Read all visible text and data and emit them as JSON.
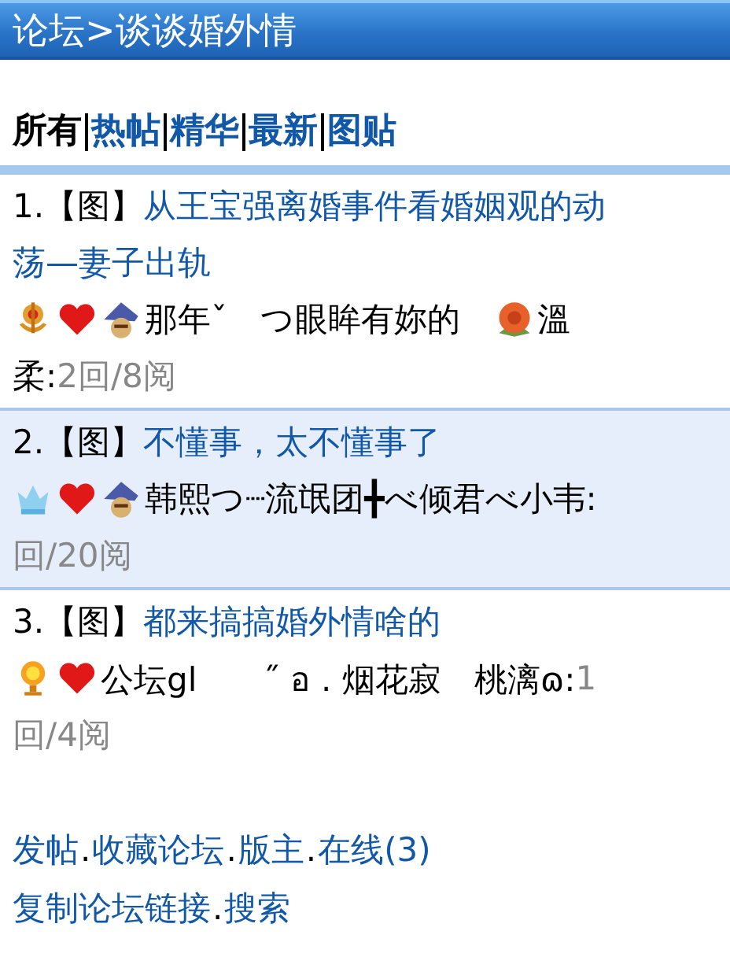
{
  "header": {
    "title": "论坛>谈谈婚外情"
  },
  "tabs": [
    {
      "label": "所有",
      "selected": true
    },
    {
      "label": "热帖",
      "selected": false
    },
    {
      "label": "精华",
      "selected": false
    },
    {
      "label": "最新",
      "selected": false
    },
    {
      "label": "图贴",
      "selected": false
    }
  ],
  "posts": [
    {
      "shaded": false,
      "lines": [
        [
          {
            "kind": "number",
            "text": "1."
          },
          {
            "kind": "tag",
            "text": "【图】"
          },
          {
            "kind": "title",
            "text": "从王宝强离婚事件看婚姻观的动"
          }
        ],
        [
          {
            "kind": "title",
            "text": "荡—妻子出轨"
          }
        ],
        [
          {
            "kind": "medal"
          },
          {
            "kind": "heart"
          },
          {
            "kind": "hat"
          },
          {
            "kind": "text",
            "text": "那年ˇ　つ眼眸有妳的　"
          },
          {
            "kind": "rose"
          },
          {
            "kind": "text",
            "text": "溫"
          }
        ],
        [
          {
            "kind": "text",
            "text": "柔:"
          },
          {
            "kind": "stats",
            "text": "2回/8阅"
          }
        ]
      ]
    },
    {
      "shaded": true,
      "lines": [
        [
          {
            "kind": "number",
            "text": "2."
          },
          {
            "kind": "tag",
            "text": "【图】"
          },
          {
            "kind": "title",
            "text": "不懂事，太不懂事了"
          }
        ],
        [
          {
            "kind": "crown"
          },
          {
            "kind": "heart"
          },
          {
            "kind": "hat"
          },
          {
            "kind": "text",
            "text": "韩熙つ┈流氓团╋べ倾君べ小韦:"
          }
        ],
        [
          {
            "kind": "stats",
            "text": "回/20阅"
          }
        ]
      ]
    },
    {
      "shaded": false,
      "lines": [
        [
          {
            "kind": "number",
            "text": "3."
          },
          {
            "kind": "tag",
            "text": "【图】"
          },
          {
            "kind": "title",
            "text": "都来搞搞婚外情啥的"
          }
        ],
        [
          {
            "kind": "sun"
          },
          {
            "kind": "heart"
          },
          {
            "kind": "text",
            "text": "公坛gl　　˝ อ . 烟花寂　桃漓ɷ:"
          },
          {
            "kind": "stats",
            "text": "1"
          }
        ],
        [
          {
            "kind": "stats",
            "text": "回/4阅"
          }
        ]
      ]
    }
  ],
  "footer": [
    [
      {
        "text": "发帖",
        "sep": "."
      },
      {
        "text": "收藏论坛",
        "sep": "."
      },
      {
        "text": "版主",
        "sep": "."
      },
      {
        "text": "在线(3)"
      }
    ],
    [
      {
        "text": "复制论坛链接",
        "sep": "."
      },
      {
        "text": "搜索"
      }
    ]
  ]
}
